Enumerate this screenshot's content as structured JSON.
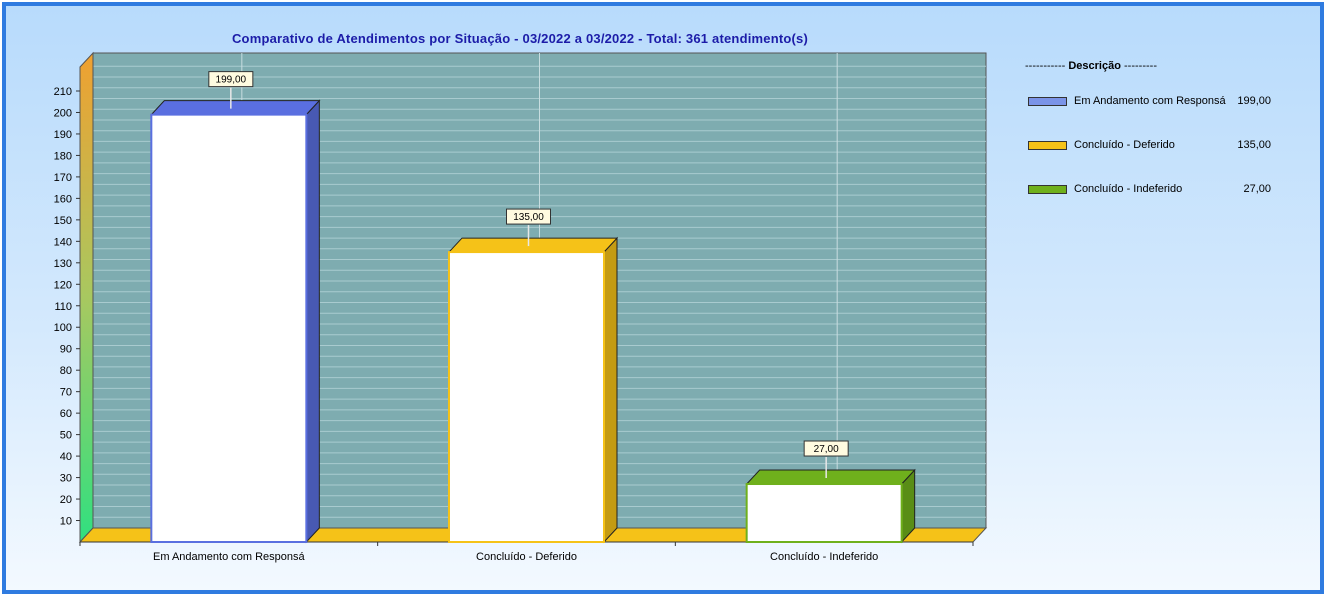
{
  "chart_data": {
    "type": "bar",
    "title": "Comparativo  de  Atendimentos  por  Situação  -  03/2022  a  03/2022  -  Total:  361  atendimento(s)",
    "categories": [
      "Em Andamento com Responsá",
      "Concluído - Deferido",
      "Concluído - Indeferido"
    ],
    "values": [
      199,
      135,
      27
    ],
    "value_labels": [
      "199,00",
      "135,00",
      "27,00"
    ],
    "colors": [
      "#5a6fe0",
      "#f5c218",
      "#6fb01c"
    ],
    "ylim": [
      0,
      210
    ],
    "yticks": [
      10,
      20,
      30,
      40,
      50,
      60,
      70,
      80,
      90,
      100,
      110,
      120,
      130,
      140,
      150,
      160,
      170,
      180,
      190,
      200,
      210
    ],
    "xlabel": "",
    "ylabel": "",
    "grid": true,
    "legend_position": "right"
  },
  "legend": {
    "header_left": "-----------",
    "header_word": "Descrição",
    "header_right": "---------",
    "items": [
      {
        "label": "Em Andamento com Responsá",
        "value": "199,00",
        "color": "#7b94e8"
      },
      {
        "label": "Concluído - Deferido",
        "value": "135,00",
        "color": "#f5c218"
      },
      {
        "label": "Concluído - Indeferido",
        "value": "27,00",
        "color": "#6fb01c"
      }
    ]
  },
  "colors": {
    "plot_background": "#7eacb0",
    "floor": "#f5c218",
    "wall": "#f0a030",
    "frame_border": "#2f7be0",
    "title": "#1c1ca8"
  }
}
